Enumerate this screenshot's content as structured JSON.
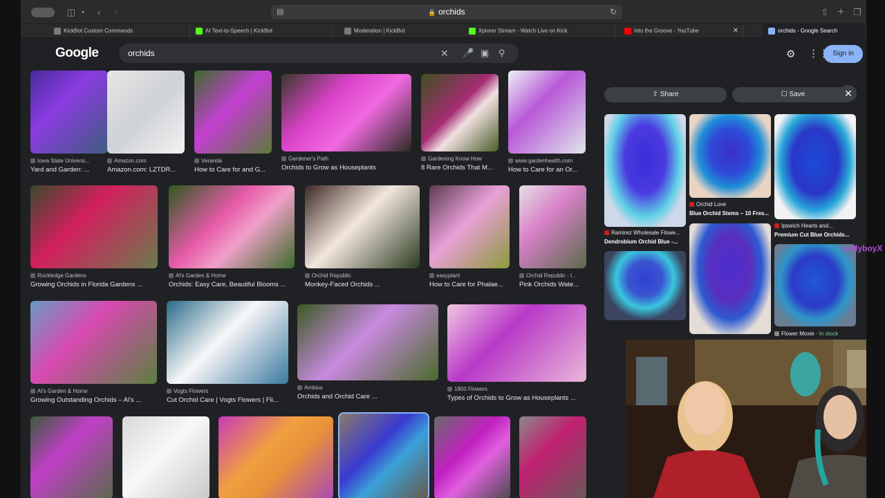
{
  "browser": {
    "url": "orchids",
    "tabs": [
      {
        "label": "KickBot Custom Commands",
        "color": "#7a7a7a"
      },
      {
        "label": "AI Text-to-Speech | KickBot",
        "color": "#53fc18"
      },
      {
        "label": "Moderation | KickBot",
        "color": "#7a7a7a"
      },
      {
        "label": "Xplorer Stream - Watch Live on Kick",
        "color": "#53fc18"
      },
      {
        "label": "Into the Groove - YouTube",
        "color": "#ff0000"
      },
      {
        "label": "orchids - Google Search",
        "color": "#8ab4f8"
      }
    ]
  },
  "google": {
    "logo": "Google",
    "query": "orchids",
    "signin": "Sign in"
  },
  "results": [
    {
      "source": "Iowa State Universi...",
      "title": "Yard and Garden: ..."
    },
    {
      "source": "Amazon.com",
      "title": "Amazon.com: LZTDR..."
    },
    {
      "source": "Veranda",
      "title": "How to Care for and G..."
    },
    {
      "source": "Gardener's Path",
      "title": "Orchids to Grow as Houseplants"
    },
    {
      "source": "Gardening Know How",
      "title": "8 Rare Orchids That M..."
    },
    {
      "source": "www.gardenhealth.com",
      "title": "How to Care for an Or..."
    },
    {
      "source": "Rockledge Gardens",
      "title": "Growing Orchids in Florida Gardens ..."
    },
    {
      "source": "Al's Garden & Home",
      "title": "Orchids: Easy Care, Beautiful Blooms ..."
    },
    {
      "source": "Orchid Republic",
      "title": "Monkey-Faced Orchids ..."
    },
    {
      "source": "easyplant",
      "title": "How to Care for Phalae..."
    },
    {
      "source": "Orchid Republic - I...",
      "title": "Pink Orchids Wate..."
    },
    {
      "source": "Al's Garden & Home",
      "title": "Growing Outstanding Orchids – Al's ..."
    },
    {
      "source": "Vogts Flowers",
      "title": "Cut Orchid Care | Vogts Flowers | Fli..."
    },
    {
      "source": "Ambius",
      "title": "Orchids and Orchid Care ..."
    },
    {
      "source": "1800 Flowers",
      "title": "Types of Orchids to Grow as Houseplants ..."
    }
  ],
  "panel": {
    "share": "Share",
    "save": "Save",
    "items": [
      {
        "source": "Orchid Love",
        "title": "Blue Orchid Stems – 10 Fres..."
      },
      {
        "source": "Ipswich Hearts and...",
        "title": "Premium Cut Blue Orchids..."
      },
      {
        "source": "Ramirez Wholesale Flowe...",
        "title": "Dendrobium Orchid Blue -..."
      },
      {
        "source": "Flower Moxie",
        "stock": "In stock"
      }
    ]
  },
  "overlay": {
    "watermark": "LadyboyX"
  }
}
